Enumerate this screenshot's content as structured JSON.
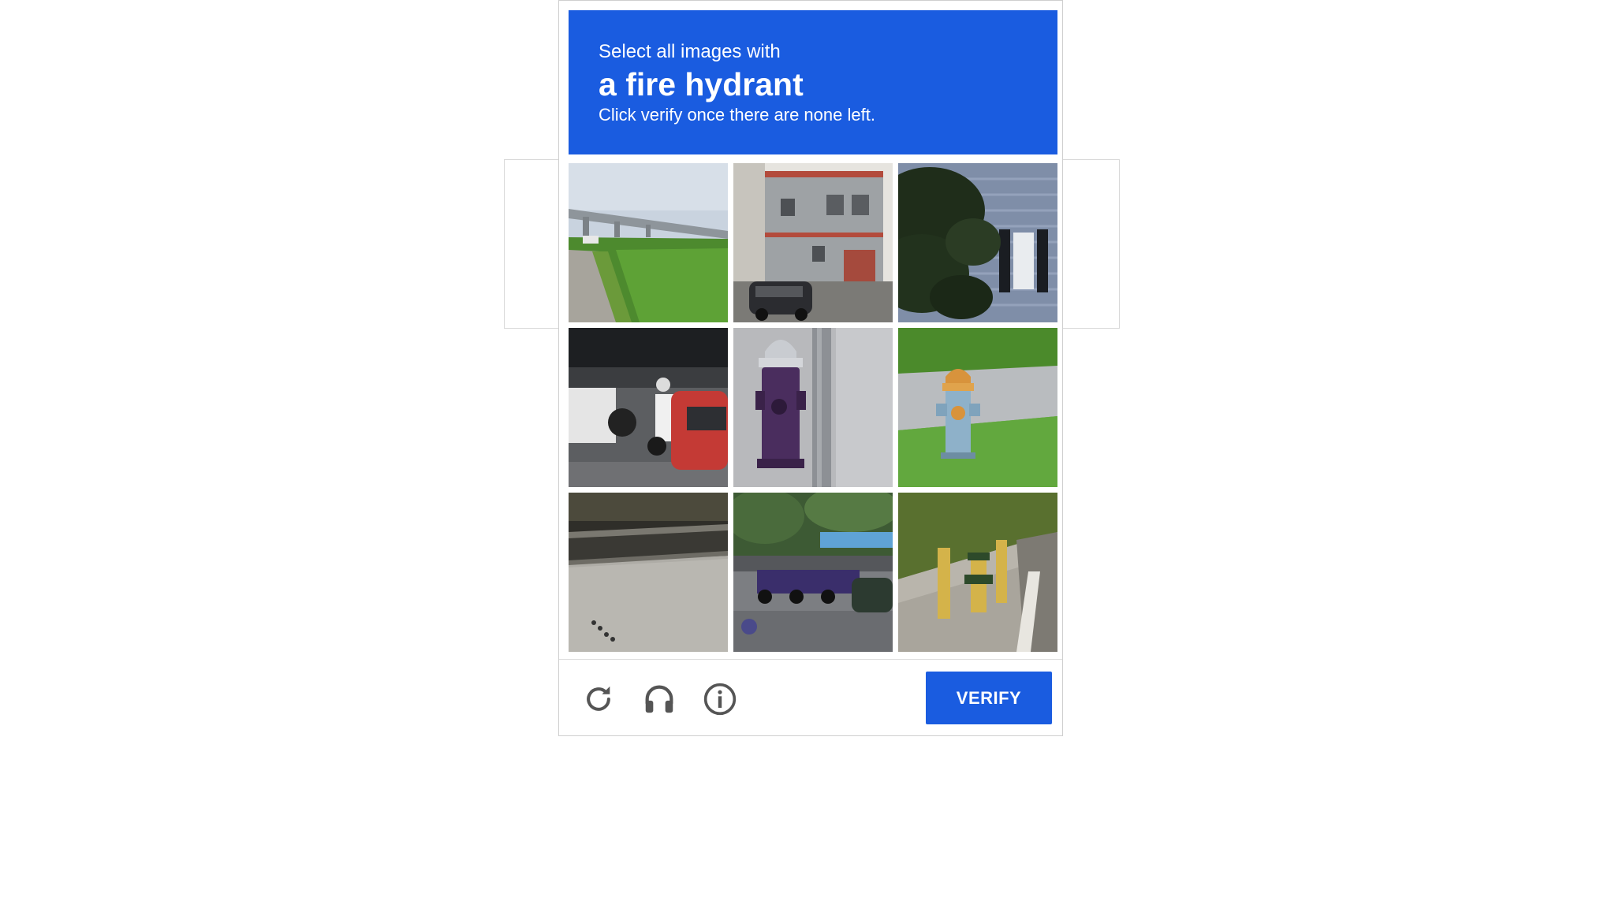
{
  "challenge": {
    "prompt_line1": "Select all images with",
    "prompt_target": "a fire hydrant",
    "prompt_line3": "Click verify once there are none left."
  },
  "tiles": [
    {
      "name": "tile-elevated-railway-field"
    },
    {
      "name": "tile-house-with-car"
    },
    {
      "name": "tile-tree-and-siding"
    },
    {
      "name": "tile-truck-and-scooter-traffic"
    },
    {
      "name": "tile-purple-fire-hydrant"
    },
    {
      "name": "tile-fire-hydrant-on-grass"
    },
    {
      "name": "tile-highway-barrier"
    },
    {
      "name": "tile-parked-motorbikes"
    },
    {
      "name": "tile-hydrant-with-bollards"
    }
  ],
  "footer": {
    "verify_label": "VERIFY",
    "icons": [
      "reload-icon",
      "headphones-icon",
      "info-icon"
    ]
  },
  "colors": {
    "accent": "#1a5ce0",
    "icon": "#555555"
  }
}
